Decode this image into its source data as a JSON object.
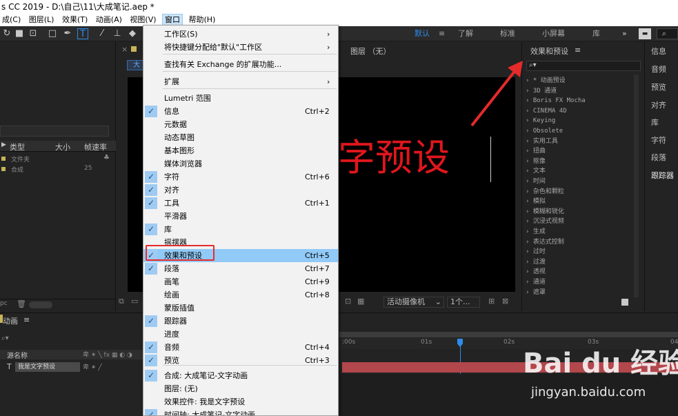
{
  "app": {
    "title": "s CC 2019 - D:\\自己\\11\\大成笔记.aep *"
  },
  "menubar": {
    "items": [
      "成(C)",
      "图层(L)",
      "效果(T)",
      "动画(A)",
      "视图(V)",
      "窗口",
      "帮助(H)"
    ]
  },
  "workspaces": [
    "默认",
    "≡",
    "了解",
    "标准",
    "小屏幕",
    "库",
    "»"
  ],
  "project_panel": {
    "col_type": "类型",
    "col_size": "大小",
    "col_fps": "帧速率",
    "rows": [
      {
        "type": "文件夹",
        "size": "",
        "fps": ""
      },
      {
        "type": "合成",
        "size": "",
        "fps": "25"
      }
    ],
    "bpc": "pc"
  },
  "comp_panel": {
    "tab_label": "大",
    "layer_tab": "图层 （无）",
    "canvas_text": "字预设",
    "camera": "活动摄像机",
    "views": "1个..."
  },
  "timeline": {
    "title": "动画",
    "col_source": "源名称",
    "layer_name": "我是文字预设",
    "layer_type": "T",
    "ruler": [
      "0s",
      "01s",
      "02s",
      "03s",
      "04"
    ],
    "ruler_start": ":00s"
  },
  "effects_panel": {
    "title": "效果和预设",
    "menu_icon": "≡",
    "search_placeholder": "",
    "items": [
      "* 动画预设",
      "3D 通道",
      "Boris FX Mocha",
      "CINEMA 4D",
      "Keying",
      "Obsolete",
      "实用工具",
      "扭曲",
      "抠像",
      "文本",
      "时间",
      "杂色和颗粒",
      "模拟",
      "模糊和锐化",
      "沉浸式视频",
      "生成",
      "表达式控制",
      "过时",
      "过渡",
      "透视",
      "通道",
      "遮罩"
    ]
  },
  "side_panels": [
    "信息",
    "音频",
    "预览",
    "对齐",
    "库",
    "字符",
    "段落",
    "跟踪器"
  ],
  "menu": {
    "items": [
      {
        "label": "工作区(S)",
        "shortcut": "",
        "checked": false,
        "submenu": true
      },
      {
        "label": "将快捷键分配给\"默认\"工作区",
        "shortcut": "",
        "checked": false,
        "submenu": true
      },
      {
        "label": "查找有关 Exchange 的扩展功能...",
        "shortcut": "",
        "checked": false,
        "submenu": false
      },
      {
        "label": "扩展",
        "shortcut": "",
        "checked": false,
        "submenu": true
      },
      {
        "label": "Lumetri 范围",
        "shortcut": "",
        "checked": false,
        "submenu": false
      },
      {
        "label": "信息",
        "shortcut": "Ctrl+2",
        "checked": true,
        "submenu": false
      },
      {
        "label": "元数据",
        "shortcut": "",
        "checked": false,
        "submenu": false
      },
      {
        "label": "动态草图",
        "shortcut": "",
        "checked": false,
        "submenu": false
      },
      {
        "label": "基本图形",
        "shortcut": "",
        "checked": false,
        "submenu": false
      },
      {
        "label": "媒体浏览器",
        "shortcut": "",
        "checked": false,
        "submenu": false
      },
      {
        "label": "字符",
        "shortcut": "Ctrl+6",
        "checked": true,
        "submenu": false
      },
      {
        "label": "对齐",
        "shortcut": "",
        "checked": true,
        "submenu": false
      },
      {
        "label": "工具",
        "shortcut": "Ctrl+1",
        "checked": true,
        "submenu": false
      },
      {
        "label": "平滑器",
        "shortcut": "",
        "checked": false,
        "submenu": false
      },
      {
        "label": "库",
        "shortcut": "",
        "checked": true,
        "submenu": false
      },
      {
        "label": "摇摆器",
        "shortcut": "",
        "checked": false,
        "submenu": false
      },
      {
        "label": "效果和预设",
        "shortcut": "Ctrl+5",
        "checked": true,
        "submenu": false,
        "highlighted": true
      },
      {
        "label": "段落",
        "shortcut": "Ctrl+7",
        "checked": true,
        "submenu": false
      },
      {
        "label": "画笔",
        "shortcut": "Ctrl+9",
        "checked": false,
        "submenu": false
      },
      {
        "label": "绘画",
        "shortcut": "Ctrl+8",
        "checked": false,
        "submenu": false
      },
      {
        "label": "蒙版插值",
        "shortcut": "",
        "checked": false,
        "submenu": false
      },
      {
        "label": "跟踪器",
        "shortcut": "",
        "checked": true,
        "submenu": false
      },
      {
        "label": "进度",
        "shortcut": "",
        "checked": false,
        "submenu": false
      },
      {
        "label": "音频",
        "shortcut": "Ctrl+4",
        "checked": true,
        "submenu": false
      },
      {
        "label": "预览",
        "shortcut": "Ctrl+3",
        "checked": true,
        "submenu": false
      },
      {
        "label": "合成: 大成笔记-文字动画",
        "shortcut": "",
        "checked": true,
        "submenu": false
      },
      {
        "label": "图层:  (无)",
        "shortcut": "",
        "checked": false,
        "submenu": false
      },
      {
        "label": "效果控件: 我是文字预设",
        "shortcut": "",
        "checked": false,
        "submenu": false
      },
      {
        "label": "时间轴: 大成笔记-文字动画",
        "shortcut": "",
        "checked": true,
        "submenu": false
      }
    ]
  },
  "watermark": {
    "brand": "Bai du 经验",
    "url": "jingyan.baidu.com"
  },
  "colors": {
    "accent": "#2d8ceb",
    "highlight": "#91c9f7",
    "annotation": "#e52a2a",
    "canvas_text": "#e0161d",
    "layer_bar": "#b2474c"
  }
}
